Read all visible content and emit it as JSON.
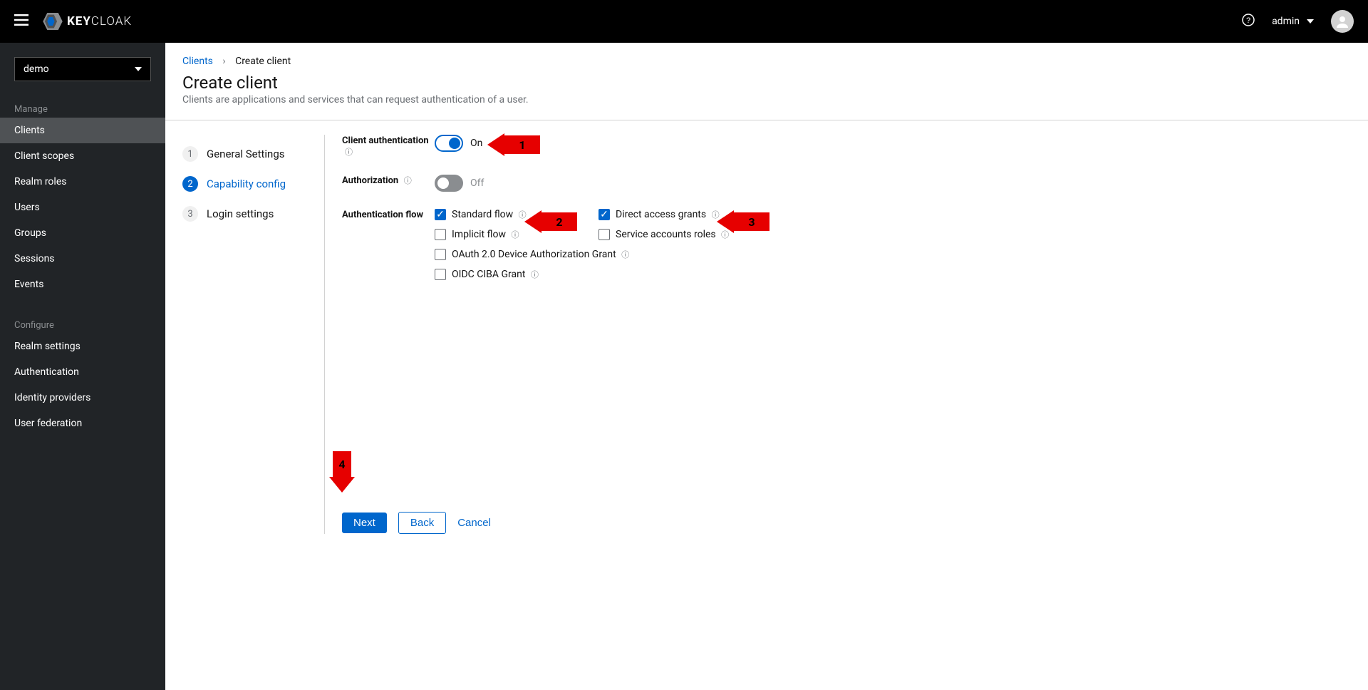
{
  "header": {
    "logo_text_a": "KEY",
    "logo_text_b": "CLOAK",
    "username": "admin"
  },
  "sidebar": {
    "realm": "demo",
    "sections": [
      {
        "title": "Manage",
        "items": [
          "Clients",
          "Client scopes",
          "Realm roles",
          "Users",
          "Groups",
          "Sessions",
          "Events"
        ]
      },
      {
        "title": "Configure",
        "items": [
          "Realm settings",
          "Authentication",
          "Identity providers",
          "User federation"
        ]
      }
    ]
  },
  "breadcrumb": {
    "parent": "Clients",
    "current": "Create client"
  },
  "page": {
    "title": "Create client",
    "desc": "Clients are applications and services that can request authentication of a user."
  },
  "wizard": {
    "steps": [
      "General Settings",
      "Capability config",
      "Login settings"
    ],
    "active_index": 1
  },
  "form": {
    "client_auth": {
      "label": "Client authentication",
      "state": "On"
    },
    "authorization": {
      "label": "Authorization",
      "state": "Off"
    },
    "auth_flow": {
      "label": "Authentication flow"
    },
    "flows": [
      {
        "label": "Standard flow",
        "checked": true
      },
      {
        "label": "Direct access grants",
        "checked": true
      },
      {
        "label": "Implicit flow",
        "checked": false
      },
      {
        "label": "Service accounts roles",
        "checked": false
      },
      {
        "label": "OAuth 2.0 Device Authorization Grant",
        "checked": false
      },
      {
        "label": "OIDC CIBA Grant",
        "checked": false
      }
    ]
  },
  "footer": {
    "next": "Next",
    "back": "Back",
    "cancel": "Cancel"
  },
  "annotations": {
    "a1": "1",
    "a2": "2",
    "a3": "3",
    "a4": "4"
  }
}
